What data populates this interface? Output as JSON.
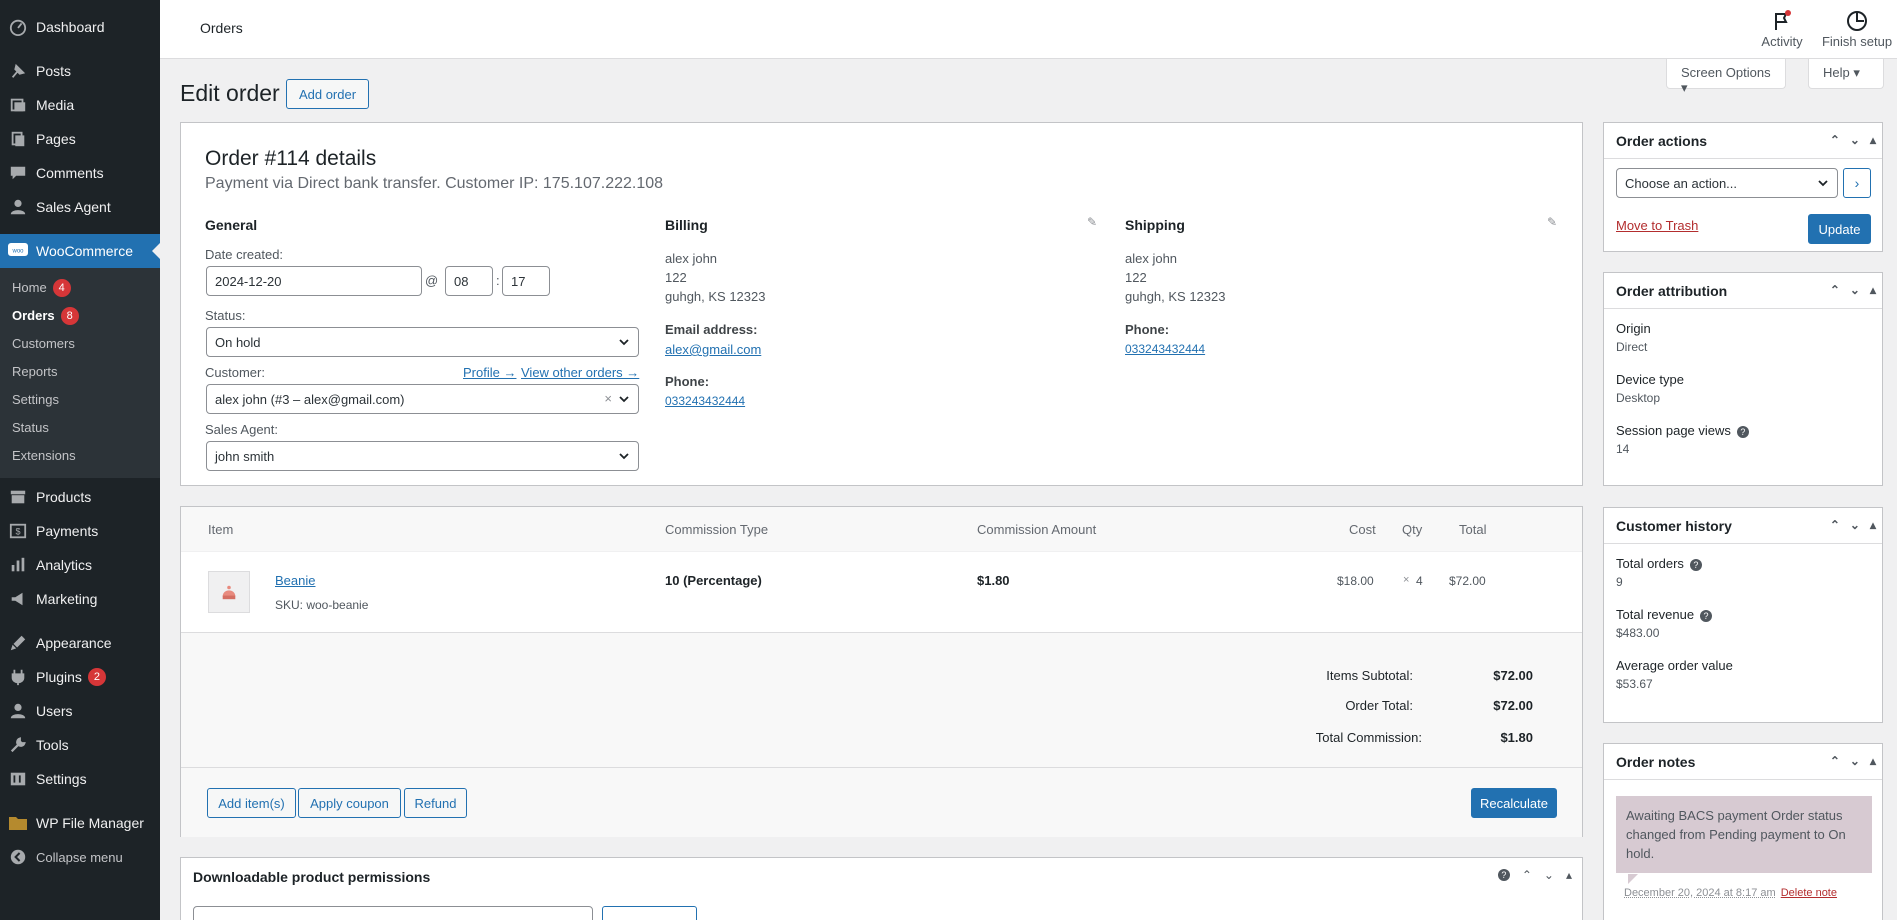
{
  "sidebar": {
    "items_top": [
      {
        "label": "Dashboard",
        "icon": "dashboard-icon"
      },
      {
        "label": "Posts",
        "icon": "pin-icon"
      },
      {
        "label": "Media",
        "icon": "media-icon"
      },
      {
        "label": "Pages",
        "icon": "pages-icon"
      },
      {
        "label": "Comments",
        "icon": "comment-icon"
      },
      {
        "label": "Sales Agent",
        "icon": "user-icon"
      }
    ],
    "woocommerce": {
      "label": "WooCommerce",
      "icon": "woo-icon"
    },
    "woo_sub": [
      {
        "label": "Home",
        "badge": "4"
      },
      {
        "label": "Orders",
        "badge": "8"
      },
      {
        "label": "Customers"
      },
      {
        "label": "Reports"
      },
      {
        "label": "Settings"
      },
      {
        "label": "Status"
      },
      {
        "label": "Extensions"
      }
    ],
    "items_mid": [
      {
        "label": "Products",
        "icon": "archive-icon"
      },
      {
        "label": "Payments",
        "icon": "dollar-icon"
      },
      {
        "label": "Analytics",
        "icon": "bar-chart-icon"
      },
      {
        "label": "Marketing",
        "icon": "megaphone-icon"
      }
    ],
    "items_bottom": [
      {
        "label": "Appearance",
        "icon": "brush-icon"
      },
      {
        "label": "Plugins",
        "icon": "plugin-icon",
        "badge": "2"
      },
      {
        "label": "Users",
        "icon": "users-icon"
      },
      {
        "label": "Tools",
        "icon": "wrench-icon"
      },
      {
        "label": "Settings",
        "icon": "settings-icon"
      }
    ],
    "file_manager": {
      "label": "WP File Manager",
      "icon": "folder-icon"
    },
    "collapse": {
      "label": "Collapse menu",
      "icon": "collapse-icon"
    }
  },
  "topbar": {
    "title": "Orders",
    "activity": "Activity",
    "finish_setup": "Finish setup"
  },
  "screen_options": "Screen Options",
  "help": "Help",
  "page": {
    "title": "Edit order",
    "add_order": "Add order"
  },
  "order": {
    "title": "Order #114 details",
    "subtitle": "Payment via Direct bank transfer. Customer IP: 175.107.222.108",
    "general": {
      "heading": "General",
      "date_label": "Date created:",
      "date": "2024-12-20",
      "at": "@",
      "hour": "08",
      "colon": ":",
      "minute": "17",
      "status_label": "Status:",
      "status": "On hold",
      "customer_label": "Customer:",
      "profile_link": "Profile →",
      "view_orders_link": "View other orders →",
      "customer": "alex john (#3 – alex@gmail.com)",
      "agent_label": "Sales Agent:",
      "agent": "john smith"
    },
    "billing": {
      "heading": "Billing",
      "address": [
        "alex john",
        "122",
        "guhgh, KS 12323"
      ],
      "email_label": "Email address:",
      "email": "alex@gmail.com",
      "phone_label": "Phone:",
      "phone": "033243432444"
    },
    "shipping": {
      "heading": "Shipping",
      "address": [
        "alex john",
        "122",
        "guhgh, KS 12323"
      ],
      "phone_label": "Phone:",
      "phone": "033243432444"
    }
  },
  "items": {
    "headers": {
      "item": "Item",
      "commission_type": "Commission Type",
      "commission_amount": "Commission Amount",
      "cost": "Cost",
      "qty": "Qty",
      "total": "Total"
    },
    "rows": [
      {
        "name": "Beanie",
        "sku": "SKU: woo-beanie",
        "commission_type": "10 (Percentage)",
        "commission_amount": "$1.80",
        "cost": "$18.00",
        "qty_x": "×",
        "qty": "4",
        "total": "$72.00"
      }
    ],
    "totals": [
      {
        "label": "Items Subtotal:",
        "value": "$72.00"
      },
      {
        "label": "Order Total:",
        "value": "$72.00"
      },
      {
        "label": "Total Commission:",
        "value": "$1.80"
      }
    ],
    "buttons": {
      "add_items": "Add item(s)",
      "apply_coupon": "Apply coupon",
      "refund": "Refund",
      "recalculate": "Recalculate"
    }
  },
  "downloads": {
    "title": "Downloadable product permissions"
  },
  "order_actions": {
    "title": "Order actions",
    "select": "Choose an action...",
    "trash": "Move to Trash",
    "update": "Update"
  },
  "attribution": {
    "title": "Order attribution",
    "origin_label": "Origin",
    "origin": "Direct",
    "device_label": "Device type",
    "device": "Desktop",
    "views_label": "Session page views",
    "views": "14"
  },
  "history": {
    "title": "Customer history",
    "total_orders_label": "Total orders",
    "total_orders": "9",
    "revenue_label": "Total revenue",
    "revenue": "$483.00",
    "aov_label": "Average order value",
    "aov": "$53.67"
  },
  "notes": {
    "title": "Order notes",
    "note": "Awaiting BACS payment Order status changed from Pending payment to On hold.",
    "meta": "December 20, 2024 at 8:17 am",
    "delete": "Delete note"
  },
  "colors": {
    "accent": "#2271b1",
    "sidebar": "#1d2327",
    "badge": "#d63638",
    "note_bg": "#d7cad2"
  }
}
